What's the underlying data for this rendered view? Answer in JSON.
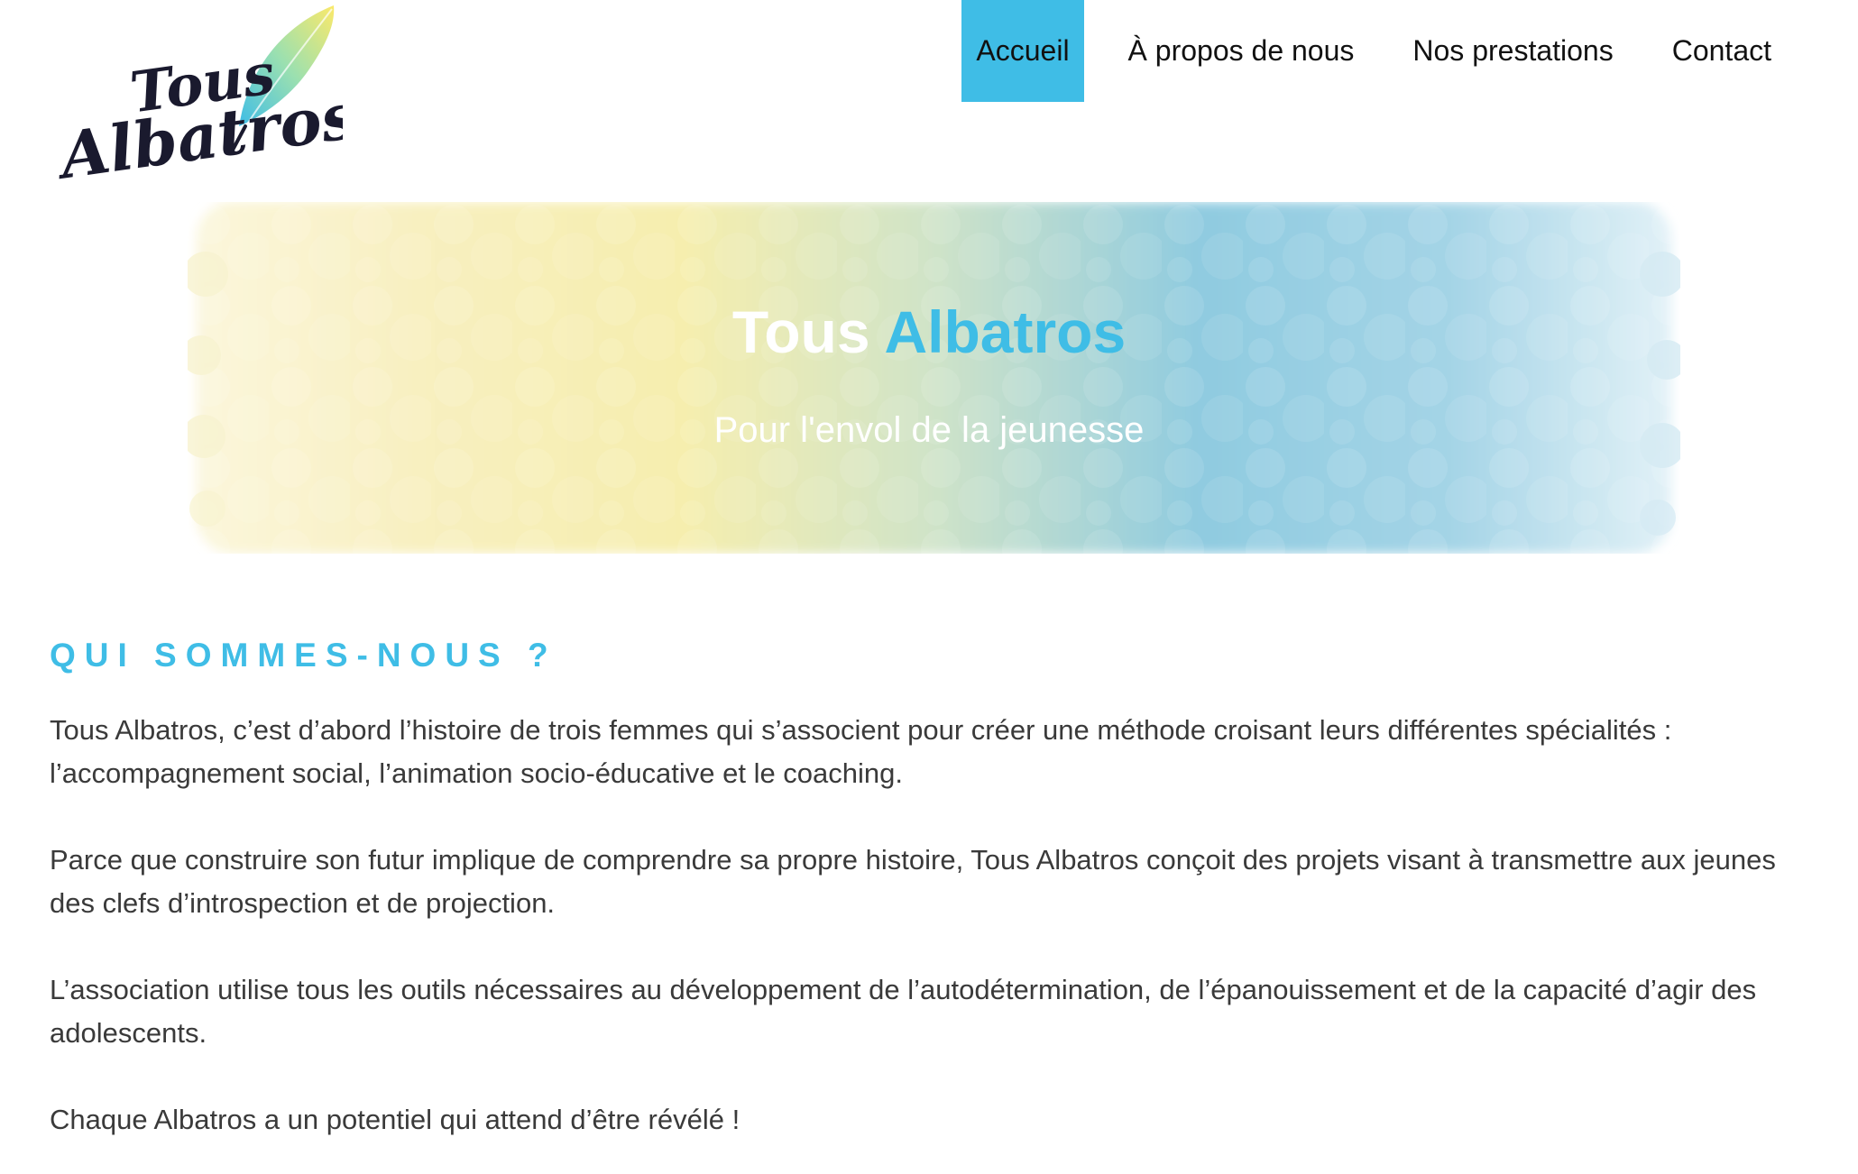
{
  "logo": {
    "line1": "Tous",
    "line2": "Albatros",
    "icon": "feather-quill-icon"
  },
  "nav": {
    "items": [
      {
        "label": "Accueil",
        "active": true
      },
      {
        "label": "À propos de nous",
        "active": false
      },
      {
        "label": "Nos prestations",
        "active": false
      },
      {
        "label": "Contact",
        "active": false
      }
    ]
  },
  "hero": {
    "title_part1": "Tous",
    "title_part2": "Albatros",
    "subtitle": "Pour l'envol de la jeunesse"
  },
  "about": {
    "heading": "QUI SOMMES-NOUS ?",
    "paragraphs": [
      "Tous Albatros, c’est d’abord l’histoire de trois femmes qui s’associent pour créer une méthode croisant leurs différentes spécialités : l’accompagnement social, l’animation socio-éducative et le coaching.",
      "Parce que construire son futur implique de comprendre sa propre histoire, Tous Albatros conçoit des projets visant à transmettre aux jeunes des clefs d’introspection et de projection.",
      "L’association utilise tous les outils nécessaires au développement de l’autodétermination, de l’épanouissement et de la capacité d’agir des adolescents.",
      "Chaque Albatros a un potentiel qui attend d’être révélé !"
    ]
  },
  "colors": {
    "accent": "#3fbde6",
    "text": "#3a3a3a",
    "watercolor_yellow": "#f7efb0",
    "watercolor_blue": "#8fcbe0"
  }
}
